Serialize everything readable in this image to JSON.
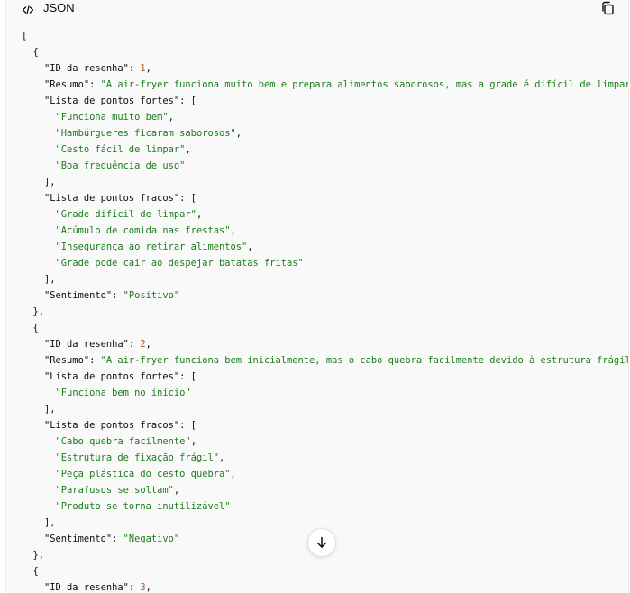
{
  "header": {
    "language_label": "JSON",
    "language_icon": "code-icon",
    "copy_icon": "copy-icon"
  },
  "code_lines": [
    [
      {
        "t": "p",
        "v": "["
      }
    ],
    [
      {
        "t": "p",
        "v": "  {"
      }
    ],
    [
      {
        "t": "p",
        "v": "    "
      },
      {
        "t": "k",
        "v": "\"ID da resenha\""
      },
      {
        "t": "p",
        "v": ": "
      },
      {
        "t": "n",
        "v": "1"
      },
      {
        "t": "p",
        "v": ","
      }
    ],
    [
      {
        "t": "p",
        "v": "    "
      },
      {
        "t": "k",
        "v": "\"Resumo\""
      },
      {
        "t": "p",
        "v": ": "
      },
      {
        "t": "s",
        "v": "\"A air-fryer funciona muito bem e prepara alimentos saborosos, mas a grade é difícil de limpar e"
      }
    ],
    [
      {
        "t": "p",
        "v": "    "
      },
      {
        "t": "k",
        "v": "\"Lista de pontos fortes\""
      },
      {
        "t": "p",
        "v": ": ["
      }
    ],
    [
      {
        "t": "p",
        "v": "      "
      },
      {
        "t": "s",
        "v": "\"Funciona muito bem\""
      },
      {
        "t": "p",
        "v": ","
      }
    ],
    [
      {
        "t": "p",
        "v": "      "
      },
      {
        "t": "s",
        "v": "\"Hambúrgueres ficaram saborosos\""
      },
      {
        "t": "p",
        "v": ","
      }
    ],
    [
      {
        "t": "p",
        "v": "      "
      },
      {
        "t": "s",
        "v": "\"Cesto fácil de limpar\""
      },
      {
        "t": "p",
        "v": ","
      }
    ],
    [
      {
        "t": "p",
        "v": "      "
      },
      {
        "t": "s",
        "v": "\"Boa frequência de uso\""
      }
    ],
    [
      {
        "t": "p",
        "v": "    ],"
      }
    ],
    [
      {
        "t": "p",
        "v": "    "
      },
      {
        "t": "k",
        "v": "\"Lista de pontos fracos\""
      },
      {
        "t": "p",
        "v": ": ["
      }
    ],
    [
      {
        "t": "p",
        "v": "      "
      },
      {
        "t": "s",
        "v": "\"Grade difícil de limpar\""
      },
      {
        "t": "p",
        "v": ","
      }
    ],
    [
      {
        "t": "p",
        "v": "      "
      },
      {
        "t": "s",
        "v": "\"Acúmulo de comida nas frestas\""
      },
      {
        "t": "p",
        "v": ","
      }
    ],
    [
      {
        "t": "p",
        "v": "      "
      },
      {
        "t": "s",
        "v": "\"Insegurança ao retirar alimentos\""
      },
      {
        "t": "p",
        "v": ","
      }
    ],
    [
      {
        "t": "p",
        "v": "      "
      },
      {
        "t": "s",
        "v": "\"Grade pode cair ao despejar batatas fritas\""
      }
    ],
    [
      {
        "t": "p",
        "v": "    ],"
      }
    ],
    [
      {
        "t": "p",
        "v": "    "
      },
      {
        "t": "k",
        "v": "\"Sentimento\""
      },
      {
        "t": "p",
        "v": ": "
      },
      {
        "t": "s",
        "v": "\"Positivo\""
      }
    ],
    [
      {
        "t": "p",
        "v": "  },"
      }
    ],
    [
      {
        "t": "p",
        "v": "  {"
      }
    ],
    [
      {
        "t": "p",
        "v": "    "
      },
      {
        "t": "k",
        "v": "\"ID da resenha\""
      },
      {
        "t": "p",
        "v": ": "
      },
      {
        "t": "n",
        "v": "2"
      },
      {
        "t": "p",
        "v": ","
      }
    ],
    [
      {
        "t": "p",
        "v": "    "
      },
      {
        "t": "k",
        "v": "\"Resumo\""
      },
      {
        "t": "p",
        "v": ": "
      },
      {
        "t": "s",
        "v": "\"A air-fryer funciona bem inicialmente, mas o cabo quebra facilmente devido à estrutura frágil de"
      }
    ],
    [
      {
        "t": "p",
        "v": "    "
      },
      {
        "t": "k",
        "v": "\"Lista de pontos fortes\""
      },
      {
        "t": "p",
        "v": ": ["
      }
    ],
    [
      {
        "t": "p",
        "v": "      "
      },
      {
        "t": "s",
        "v": "\"Funciona bem no início\""
      }
    ],
    [
      {
        "t": "p",
        "v": "    ],"
      }
    ],
    [
      {
        "t": "p",
        "v": "    "
      },
      {
        "t": "k",
        "v": "\"Lista de pontos fracos\""
      },
      {
        "t": "p",
        "v": ": ["
      }
    ],
    [
      {
        "t": "p",
        "v": "      "
      },
      {
        "t": "s",
        "v": "\"Cabo quebra facilmente\""
      },
      {
        "t": "p",
        "v": ","
      }
    ],
    [
      {
        "t": "p",
        "v": "      "
      },
      {
        "t": "s",
        "v": "\"Estrutura de fixação frágil\""
      },
      {
        "t": "p",
        "v": ","
      }
    ],
    [
      {
        "t": "p",
        "v": "      "
      },
      {
        "t": "s",
        "v": "\"Peça plástica do cesto quebra\""
      },
      {
        "t": "p",
        "v": ","
      }
    ],
    [
      {
        "t": "p",
        "v": "      "
      },
      {
        "t": "s",
        "v": "\"Parafusos se soltam\""
      },
      {
        "t": "p",
        "v": ","
      }
    ],
    [
      {
        "t": "p",
        "v": "      "
      },
      {
        "t": "s",
        "v": "\"Produto se torna inutilizável\""
      }
    ],
    [
      {
        "t": "p",
        "v": "    ],"
      }
    ],
    [
      {
        "t": "p",
        "v": "    "
      },
      {
        "t": "k",
        "v": "\"Sentimento\""
      },
      {
        "t": "p",
        "v": ": "
      },
      {
        "t": "s",
        "v": "\"Negativo\""
      }
    ],
    [
      {
        "t": "p",
        "v": "  },"
      }
    ],
    [
      {
        "t": "p",
        "v": "  {"
      }
    ],
    [
      {
        "t": "p",
        "v": "    "
      },
      {
        "t": "k",
        "v": "\"ID da resenha\""
      },
      {
        "t": "p",
        "v": ": "
      },
      {
        "t": "n",
        "v": "3"
      },
      {
        "t": "p",
        "v": ","
      }
    ]
  ],
  "scroll_button": {
    "icon": "arrow-down-icon"
  },
  "colors": {
    "string": "#1a7d1a",
    "number": "#b4531c",
    "text": "#0d0d0d",
    "panel_bg": "#f9f9f9"
  }
}
